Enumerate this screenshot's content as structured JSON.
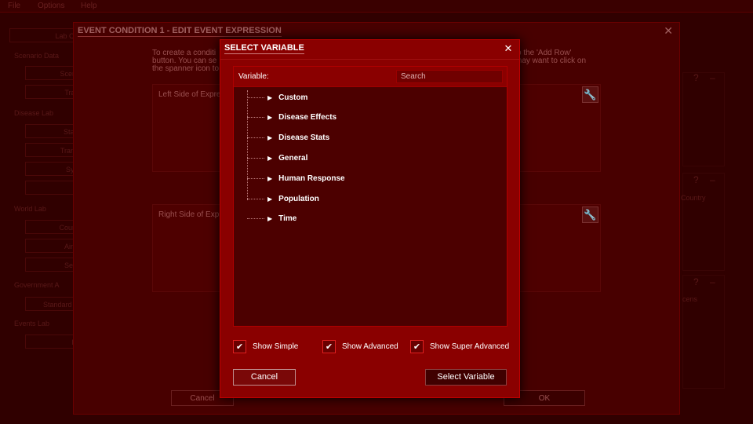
{
  "menubar": {
    "items": [
      "File",
      "Options",
      "Help"
    ]
  },
  "sidebar": {
    "top_button": "Lab Cont",
    "sections": [
      {
        "label": "Scenario Data",
        "items": [
          "Scenari",
          "Transl"
        ]
      },
      {
        "label": "Disease Lab",
        "items": [
          "Startin",
          "Transm",
          "Symp",
          "Abi"
        ]
      },
      {
        "label": "World Lab",
        "items": [
          "Country",
          "Air Ro",
          "Sea R"
        ]
      },
      {
        "label": "Government A",
        "items": [
          "Standard Pla"
        ]
      },
      {
        "label": "Events Lab",
        "items": [
          "Eve"
        ]
      }
    ]
  },
  "right_panel": {
    "texts": [
      "Country",
      "cens"
    ],
    "help_glyph": "?",
    "collapse_glyph": "–"
  },
  "editor": {
    "title": "EVENT CONDITION 1 - EDIT EVENT EXPRESSION",
    "close_glyph": "✕",
    "intro_lines": [
      "To create a conditi",
      "button. You can se",
      "the spanner icon to"
    ],
    "intro_right_lines": [
      "o the 'Add Row'",
      "may want to click on"
    ],
    "left_side_label": "Left Side of Expres",
    "right_side_label": "Right Side of Expre",
    "cancel_label": "Cancel",
    "ok_label": "OK"
  },
  "dialog": {
    "title": "SELECT VARIABLE",
    "close_glyph": "✕",
    "variable_label": "Variable:",
    "search_placeholder": "Search",
    "tree": [
      "Custom",
      "Disease Effects",
      "Disease Stats",
      "General",
      "Human Response",
      "Population",
      "Time"
    ],
    "checkboxes": [
      {
        "label": "Show Simple",
        "checked": true
      },
      {
        "label": "Show Advanced",
        "checked": true
      },
      {
        "label": "Show Super Advanced",
        "checked": true
      }
    ],
    "cancel_label": "Cancel",
    "select_label": "Select Variable"
  },
  "colors": {
    "accent": "#8a0000",
    "border": "#c00000",
    "background": "#300000"
  },
  "icons": {
    "wrench": "wrench-add-icon",
    "expand": "triangle-right-icon",
    "check": "checkmark-icon"
  }
}
